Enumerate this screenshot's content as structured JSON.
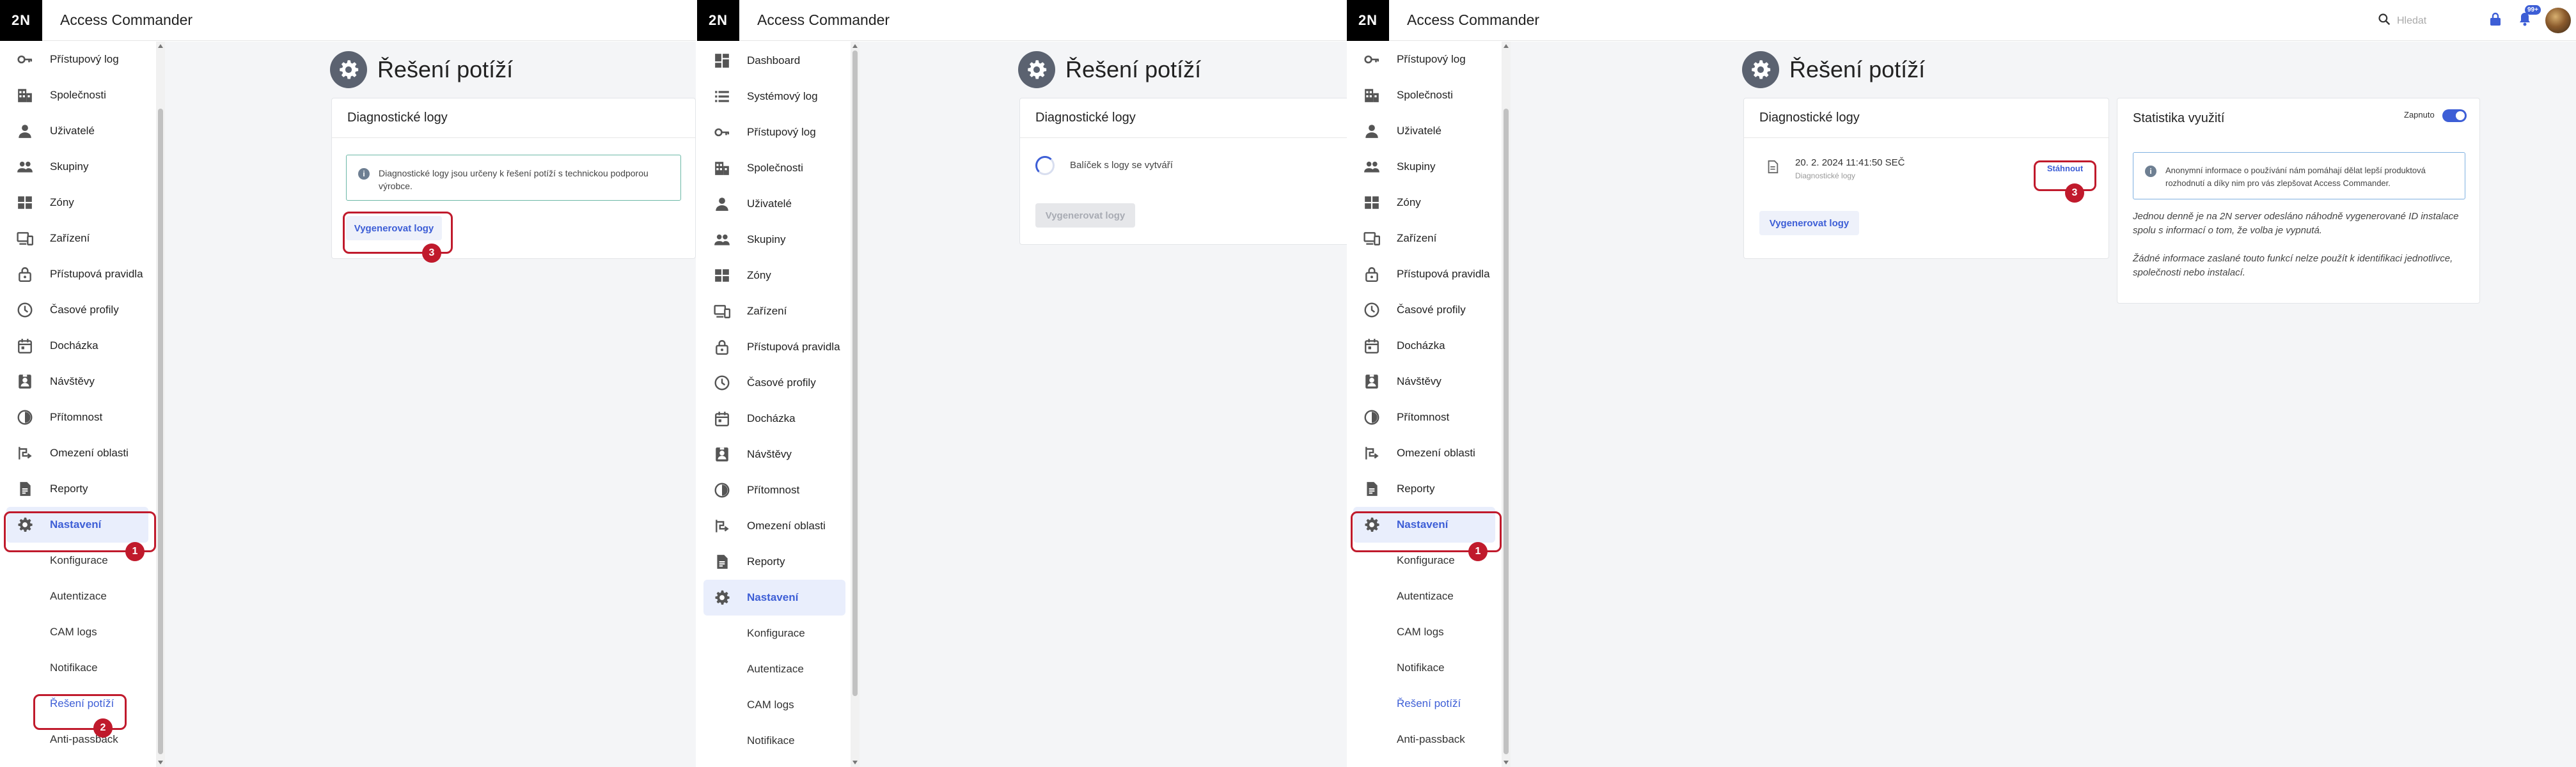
{
  "app": {
    "logo": "2N",
    "title": "Access Commander"
  },
  "page": {
    "title": "Řešení potíží"
  },
  "panel1": {
    "nav": [
      "Přístupový log",
      "Společnosti",
      "Uživatelé",
      "Skupiny",
      "Zóny",
      "Zařízení",
      "Přístupová pravidla",
      "Časové profily",
      "Docházka",
      "Návštěvy",
      "Přítomnost",
      "Omezení oblasti",
      "Reporty",
      "Nastavení"
    ],
    "sub": [
      "Konfigurace",
      "Autentizace",
      "CAM logs",
      "Notifikace",
      "Řešení potíží",
      "Anti-passback"
    ],
    "card_title": "Diagnostické logy",
    "info_text": "Diagnostické logy jsou určeny k řešení potíží s technickou podporou výrobce.",
    "generate_label": "Vygenerovat logy",
    "badges": [
      "1",
      "2",
      "3"
    ]
  },
  "panel2": {
    "nav": [
      "Dashboard",
      "Systémový log",
      "Přístupový log",
      "Společnosti",
      "Uživatelé",
      "Skupiny",
      "Zóny",
      "Zařízení",
      "Přístupová pravidla",
      "Časové profily",
      "Docházka",
      "Návštěvy",
      "Přítomnost",
      "Omezení oblasti",
      "Reporty",
      "Nastavení"
    ],
    "sub": [
      "Konfigurace",
      "Autentizace",
      "CAM logs",
      "Notifikace"
    ],
    "card_title": "Diagnostické logy",
    "progress_text": "Balíček s logy se vytváří",
    "generate_label": "Vygenerovat logy"
  },
  "panel3": {
    "search_placeholder": "Hledat",
    "notifications_count": "99+",
    "nav": [
      "Přístupový log",
      "Společnosti",
      "Uživatelé",
      "Skupiny",
      "Zóny",
      "Zařízení",
      "Přístupová pravidla",
      "Časové profily",
      "Docházka",
      "Návštěvy",
      "Přítomnost",
      "Omezení oblasti",
      "Reporty",
      "Nastavení"
    ],
    "sub": [
      "Konfigurace",
      "Autentizace",
      "CAM logs",
      "Notifikace",
      "Řešení potíží",
      "Anti-passback"
    ],
    "card_title": "Diagnostické logy",
    "log_date": "20. 2. 2024 11:41:50 SEČ",
    "log_type": "Diagnostické logy",
    "download_label": "Stáhnout",
    "generate_label": "Vygenerovat logy",
    "stats_title": "Statistika využití",
    "toggle_label": "Zapnuto",
    "stats_info": "Anonymní informace o používání nám pomáhají dělat lepší produktová rozhodnutí a díky nim pro vás zlepšovat Access Commander.",
    "stats_p1": "Jednou denně je na 2N server odesláno náhodně vygenerované ID instalace spolu s informací o tom, že volba je vypnutá.",
    "stats_p2": "Žádné informace zaslané touto funkcí nelze použít k identifikaci jednotlivce, společnosti nebo instalací.",
    "badges": [
      "1",
      "3"
    ]
  },
  "colors": {
    "accent": "#3d5ed6",
    "annotation": "#c01a2c",
    "logo_bg": "#000000"
  },
  "icons": [
    "key-icon",
    "building-icon",
    "person-icon",
    "group-icon",
    "grid-icon",
    "devices-icon",
    "lock-icon",
    "clock-icon",
    "calendar-icon",
    "visitor-icon",
    "presence-icon",
    "area-icon",
    "report-icon",
    "gear-icon",
    "dashboard-icon",
    "list-icon",
    "search-icon",
    "bell-icon",
    "info-icon",
    "file-icon"
  ]
}
